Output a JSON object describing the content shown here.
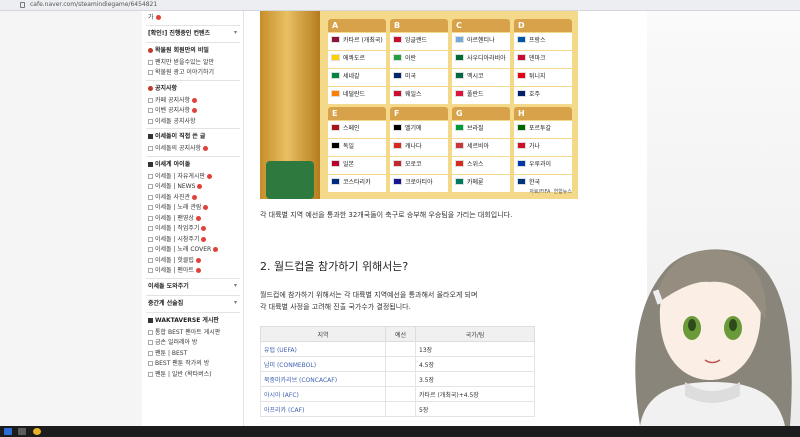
{
  "browser": {
    "url": "cafe.naver.com/steamindiegame/6454821"
  },
  "sidebar": {
    "items": [
      {
        "label": "가",
        "type": "link-badge"
      },
      {
        "label": "[확인!] 진행중인 컨텐츠",
        "type": "head-chev"
      },
      {
        "label": "왁물원 회원만의 비밀",
        "type": "head-icon"
      },
      {
        "label": "팬치만 받을수있는 알만",
        "type": "sub"
      },
      {
        "label": "왁물원 광고 이야기하기",
        "type": "sub"
      },
      {
        "label": "공지사항",
        "type": "head-icon"
      },
      {
        "label": "카페 공지사항",
        "type": "sub-badge"
      },
      {
        "label": "이벤 공지사항",
        "type": "sub-badge"
      },
      {
        "label": "이세돌 공지사항",
        "type": "sub"
      },
      {
        "label": "이세돌이 직접 쓴 글",
        "type": "head-sq"
      },
      {
        "label": "이세돌의 공지사항",
        "type": "sub-badge"
      },
      {
        "label": "이세계 아이돌",
        "type": "head-sq"
      },
      {
        "label": "이세돌 | 자유게시판",
        "type": "sub-badge"
      },
      {
        "label": "이세돌 | NEWS",
        "type": "sub-badge"
      },
      {
        "label": "이세돌 사진관",
        "type": "sub-badge"
      },
      {
        "label": "이세돌 | 노래 관람",
        "type": "sub-badge"
      },
      {
        "label": "이세돌 | 팬영상",
        "type": "sub-badge"
      },
      {
        "label": "이세돌 | 작업주기",
        "type": "sub-badge"
      },
      {
        "label": "이세돌 | 시참주기",
        "type": "sub-badge"
      },
      {
        "label": "이세돌 | 노래 COVER",
        "type": "sub-badge"
      },
      {
        "label": "이세돌 | 핫클립",
        "type": "sub-badge"
      },
      {
        "label": "이세돌 | 팬아트",
        "type": "sub-badge"
      },
      {
        "label": "이세돌 도와주기",
        "type": "head-chev"
      },
      {
        "label": "중간계 선술집",
        "type": "head-chev"
      },
      {
        "label": "WAKTAVERSE 게시판",
        "type": "head-sq"
      },
      {
        "label": "통합 BEST 팬아트 게시판",
        "type": "sub"
      },
      {
        "label": "금손 일러레아 방",
        "type": "sub"
      },
      {
        "label": "팬툰 | BEST",
        "type": "sub"
      },
      {
        "label": "BEST 팬툰 작가의 방",
        "type": "sub"
      },
      {
        "label": "팬툰 | 일반 (왁타버스)",
        "type": "sub"
      }
    ]
  },
  "worldcup": {
    "groups": [
      {
        "letter": "A",
        "teams": [
          "카타르 (개최국)",
          "에콰도르",
          "세네갈",
          "네덜란드"
        ]
      },
      {
        "letter": "B",
        "teams": [
          "잉글랜드",
          "이란",
          "미국",
          "웨일스"
        ]
      },
      {
        "letter": "C",
        "teams": [
          "아르헨티나",
          "사우디아라비아",
          "멕시코",
          "폴란드"
        ]
      },
      {
        "letter": "D",
        "teams": [
          "프랑스",
          "덴마크",
          "튀니지",
          "호주"
        ]
      },
      {
        "letter": "E",
        "teams": [
          "스페인",
          "독일",
          "일본",
          "코스타리카"
        ]
      },
      {
        "letter": "F",
        "teams": [
          "벨기에",
          "캐나다",
          "모로코",
          "크로아티아"
        ]
      },
      {
        "letter": "G",
        "teams": [
          "브라질",
          "세르비아",
          "스위스",
          "카메룬"
        ]
      },
      {
        "letter": "H",
        "teams": [
          "포르투갈",
          "가나",
          "우루과이",
          "한국"
        ]
      }
    ],
    "source": "자료/FIFA",
    "agency": "연합뉴스"
  },
  "article": {
    "para1": "각 대륙별 지역 예선을 통과한 32개국들이 축구로 승부해 우승팀을 가리는 대회입니다.",
    "h2": "2. 월드컵을 참가하기 위해서는?",
    "para2": "월드컵에 참가하기 위해서는 각 대륙별 지역예선을 통과해서 올라오게 되며",
    "para3": "각 대륙별 사정을 고려해 진출 국가수가 결정됩니다."
  },
  "table": {
    "headers": [
      "지역",
      "예선",
      "국가/팀"
    ],
    "rows": [
      [
        "유럽 (UEFA)",
        "",
        "13장"
      ],
      [
        "남미 (CONMEBOL)",
        "",
        "4.5장"
      ],
      [
        "북중미카리브 (CONCACAF)",
        "",
        "3.5장"
      ],
      [
        "아시아 (AFC)",
        "",
        "카타르 (개최국)+4.5장"
      ],
      [
        "아프리카 (CAF)",
        "",
        "5장"
      ]
    ]
  }
}
